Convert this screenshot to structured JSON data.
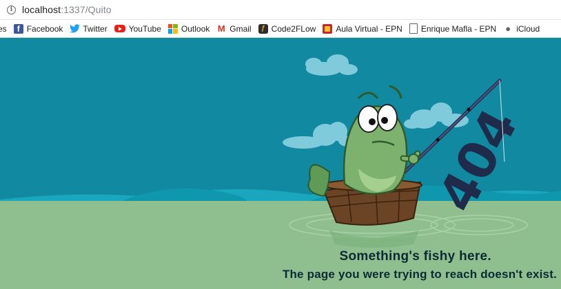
{
  "address_bar": {
    "host": "localhost",
    "path": ":1337/Quito"
  },
  "bookmarks": [
    {
      "label": "es",
      "icon": "folder-partial-icon"
    },
    {
      "label": "Facebook",
      "icon": "facebook-icon"
    },
    {
      "label": "Twitter",
      "icon": "twitter-icon"
    },
    {
      "label": "YouTube",
      "icon": "youtube-icon"
    },
    {
      "label": "Outlook",
      "icon": "microsoft-icon"
    },
    {
      "label": "Gmail",
      "icon": "gmail-icon"
    },
    {
      "label": "Code2FLow",
      "icon": "code2flow-icon"
    },
    {
      "label": "Aula Virtual - EPN",
      "icon": "aula-virtual-icon"
    },
    {
      "label": "Enrique Mafla - EPN",
      "icon": "document-icon"
    },
    {
      "label": "iCloud",
      "icon": "apple-icon"
    }
  ],
  "page": {
    "code": "404",
    "title": "Something's fishy here.",
    "subtitle": "The page you were trying to reach doesn't exist.",
    "colors": {
      "sky": "#118aa1",
      "sea": "#8fbf8f",
      "text": "#0b2a33",
      "fish": "#7cb26d",
      "boat": "#6b4426",
      "code_text": "#1f2b4a"
    }
  }
}
